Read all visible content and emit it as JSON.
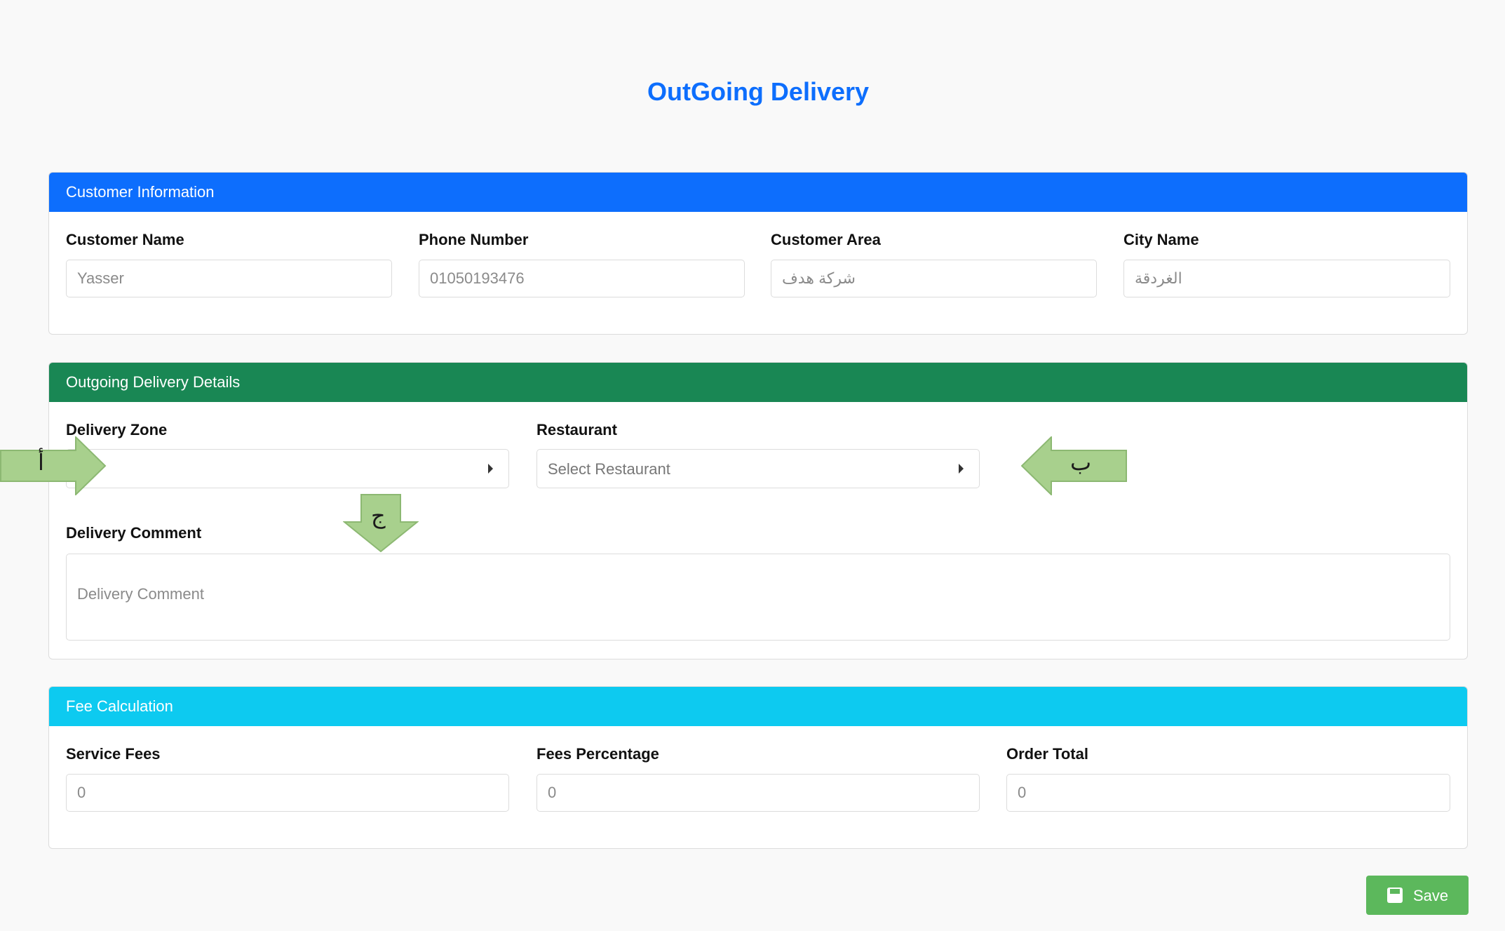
{
  "page": {
    "title": "OutGoing Delivery"
  },
  "colors": {
    "customer_header": "#0d6efd",
    "delivery_header": "#198754",
    "fees_header": "#0dcaf0",
    "save_button": "#5cb85c",
    "annotation_arrow": "#a8d08d"
  },
  "customer": {
    "header": "Customer Information",
    "fields": {
      "name": {
        "label": "Customer Name",
        "placeholder": "Yasser"
      },
      "phone": {
        "label": "Phone Number",
        "placeholder": "01050193476"
      },
      "area": {
        "label": "Customer Area",
        "placeholder": "شركة هدف"
      },
      "city": {
        "label": "City Name",
        "placeholder": "الغردقة"
      }
    }
  },
  "delivery": {
    "header": "Outgoing Delivery Details",
    "zone": {
      "label": "Delivery Zone",
      "value": ""
    },
    "restaurant": {
      "label": "Restaurant",
      "value": "Select Restaurant"
    },
    "comment": {
      "label": "Delivery Comment",
      "placeholder": "Delivery Comment"
    }
  },
  "fees": {
    "header": "Fee Calculation",
    "service_fees": {
      "label": "Service Fees",
      "placeholder": "0"
    },
    "fees_percentage": {
      "label": "Fees Percentage",
      "placeholder": "0"
    },
    "order_total": {
      "label": "Order Total",
      "placeholder": "0"
    }
  },
  "actions": {
    "save_label": "Save",
    "save_icon": "floppy-disk-icon"
  },
  "annotations": {
    "a": "أ",
    "b": "ب",
    "c": "ج"
  }
}
